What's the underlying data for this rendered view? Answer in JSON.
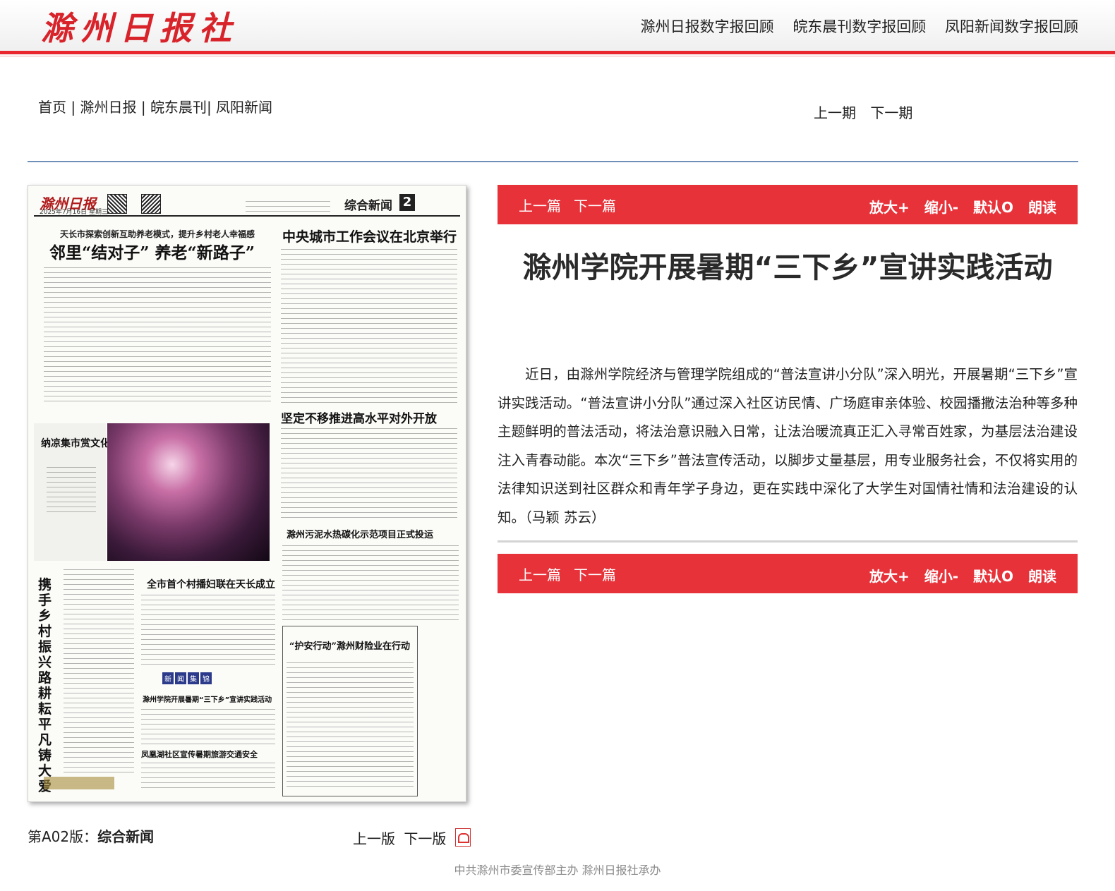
{
  "header": {
    "logo_text": "滁州日报社",
    "links": [
      "滁州日报数字报回顾",
      "皖东晨刊数字报回顾",
      "凤阳新闻数字报回顾"
    ]
  },
  "nav": {
    "home": "首页",
    "sep": "|",
    "papers": [
      "滁州日报",
      "皖东晨刊",
      "凤阳新闻"
    ]
  },
  "issue_nav": {
    "prev": "上一期",
    "next": "下一期"
  },
  "paper_page": {
    "masthead": "滁州日报",
    "date": "2025年7月16日 星期三",
    "section": "综合新闻",
    "page_no": "2",
    "kicker": "天长市探索创新互助养老模式，提升乡村老人幸福感",
    "headline_main": "邻里“结对子” 养老“新路子”",
    "headline_right": "中央城市工作会议在北京举行",
    "headline_open": "坚定不移推进高水平对外开放",
    "headline_sludge": "滁州污泥水热碳化示范项目正式投运",
    "headline_liveroom": "全市首个村播妇联在天长成立",
    "headline_finance": "“护安行动”滁州财险业在行动",
    "headline_college": "滁州学院开展暑期“三下乡”宣讲实践活动",
    "headline_fenghuang": "凤凰湖社区宣传暑期旅游交通安全",
    "headline_photo": "纳凉集市赏文化盛宴",
    "vertical_headline": "携手乡村振兴路 耕耘平凡铸大爱",
    "brief_tags": [
      "新",
      "闻",
      "集",
      "锦"
    ]
  },
  "page_label": {
    "prefix": "第A02版：",
    "name": "综合新闻"
  },
  "page_nav": {
    "prev": "上一版",
    "next": "下一版"
  },
  "article_bar": {
    "prev": "上一篇",
    "next": "下一篇",
    "zoom_in": "放大+",
    "zoom_out": "缩小-",
    "reset": "默认O",
    "read": "朗读"
  },
  "article": {
    "title": "滁州学院开展暑期“三下乡”宣讲实践活动",
    "body": "近日，由滁州学院经济与管理学院组成的“普法宣讲小分队”深入明光，开展暑期“三下乡”宣讲实践活动。“普法宣讲小分队”通过深入社区访民情、广场庭审亲体验、校园播撒法治种等多种主题鲜明的普法活动，将法治意识融入日常，让法治暖流真正汇入寻常百姓家，为基层法治建设注入青春动能。本次“三下乡”普法宣传活动，以脚步丈量基层，用专业服务社会，不仅将实用的法律知识送到社区群众和青年学子身边，更在实践中深化了大学生对国情社情和法治建设的认知。（马颖 苏云）"
  },
  "footer": "中共滁州市委宣传部主办 滁州日报社承办",
  "colors": {
    "brand_red": "#e8323a",
    "rule_blue": "#6d8fb8"
  }
}
